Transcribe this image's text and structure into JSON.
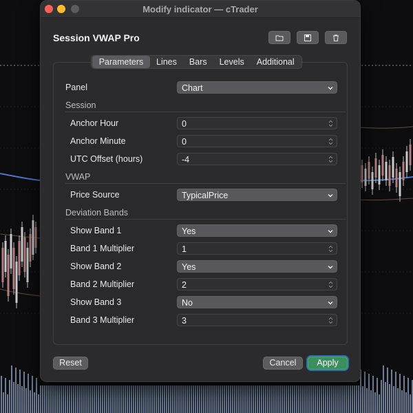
{
  "window": {
    "title": "Modify indicator — cTrader",
    "indicator_name": "Session VWAP Pro"
  },
  "toolbar": {
    "icons": [
      "folder-icon",
      "save-icon",
      "trash-icon"
    ]
  },
  "tabs": [
    {
      "label": "Parameters",
      "active": true
    },
    {
      "label": "Lines",
      "active": false
    },
    {
      "label": "Bars",
      "active": false
    },
    {
      "label": "Levels",
      "active": false
    },
    {
      "label": "Additional",
      "active": false
    }
  ],
  "params": {
    "panel": {
      "label": "Panel",
      "value": "Chart"
    },
    "session": {
      "title": "Session",
      "anchor_hour": {
        "label": "Anchor Hour",
        "value": "0"
      },
      "anchor_minute": {
        "label": "Anchor Minute",
        "value": "0"
      },
      "utc_offset": {
        "label": "UTC Offset (hours)",
        "value": "-4"
      }
    },
    "vwap": {
      "title": "VWAP",
      "price_source": {
        "label": "Price Source",
        "value": "TypicalPrice"
      }
    },
    "bands": {
      "title": "Deviation Bands",
      "show_band_1": {
        "label": "Show Band 1",
        "value": "Yes"
      },
      "band_1_mult": {
        "label": "Band 1 Multiplier",
        "value": "1"
      },
      "show_band_2": {
        "label": "Show Band 2",
        "value": "Yes"
      },
      "band_2_mult": {
        "label": "Band 2 Multiplier",
        "value": "2"
      },
      "show_band_3": {
        "label": "Show Band 3",
        "value": "No"
      },
      "band_3_mult": {
        "label": "Band 3 Multiplier",
        "value": "3"
      }
    }
  },
  "footer": {
    "reset_label": "Reset",
    "cancel_label": "Cancel",
    "apply_label": "Apply"
  },
  "colors": {
    "apply_green": "#3b8f5c",
    "focus_ring": "#2f6fa8",
    "close": "#fe5f57",
    "minimize": "#febc2e"
  }
}
